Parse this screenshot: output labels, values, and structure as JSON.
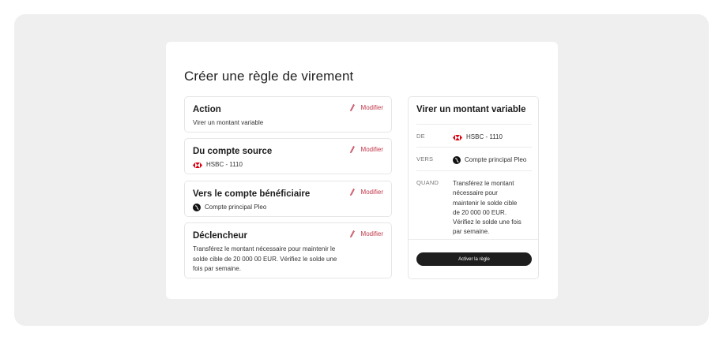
{
  "page": {
    "title": "Créer une règle de virement"
  },
  "cards": {
    "action": {
      "title": "Action",
      "body": "Virer un montant variable",
      "modify_label": "Modifier"
    },
    "source": {
      "title": "Du compte source",
      "account": "HSBC - 1110",
      "account_icon": "hsbc-icon",
      "modify_label": "Modifier"
    },
    "beneficiary": {
      "title": "Vers le compte bénéficiaire",
      "account": "Compte principal Pleo",
      "account_icon": "pleo-icon",
      "modify_label": "Modifier"
    },
    "trigger": {
      "title": "Déclencheur",
      "body": "Transférez le montant nécessaire pour maintenir le solde cible de 20 000 00 EUR. Vérifiez le solde une fois par semaine.",
      "modify_label": "Modifier"
    }
  },
  "summary": {
    "title": "Virer un montant variable",
    "from_label": "DE",
    "from_value": "HSBC - 1110",
    "to_label": "VERS",
    "to_value": "Compte principal Pleo",
    "when_label": "QUAND",
    "when_value": "Transférez le montant nécessaire pour maintenir le solde cible de 20 000 00 EUR. Vérifiez le solde une fois par semaine.",
    "cta_label": "Activer la règle"
  },
  "colors": {
    "accent": "#c0394b",
    "hsbc_red": "#db0011",
    "button_bg": "#1e1e1e",
    "frame_bg": "#efefef"
  }
}
